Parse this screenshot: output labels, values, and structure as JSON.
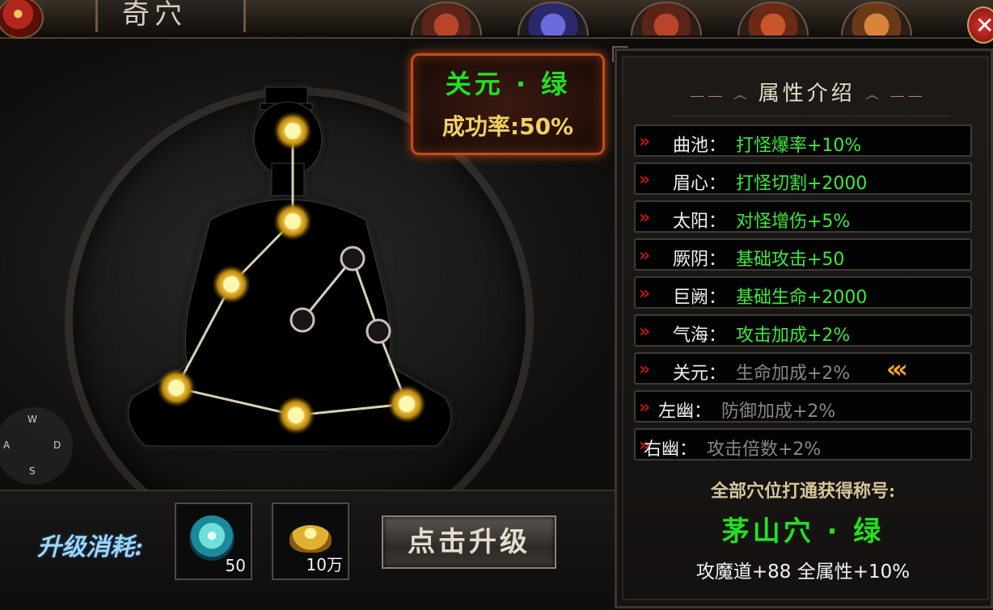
{
  "window": {
    "title": "奇穴",
    "menu_icons": [
      "scroll-icon",
      "flower-icon",
      "robe-icon",
      "pouch-icon",
      "scroll-bundle-icon"
    ],
    "close_icon": "close-icon"
  },
  "acupoint": {
    "name": "关元 · 绿",
    "success_rate": "成功率:50%"
  },
  "meridian": {
    "points": [
      {
        "id": "quchi",
        "lit": true
      },
      {
        "id": "meixin",
        "lit": true
      },
      {
        "id": "taiyang",
        "lit": true
      },
      {
        "id": "jueyin",
        "lit": true
      },
      {
        "id": "juque",
        "lit": true
      },
      {
        "id": "qihai",
        "lit": true
      },
      {
        "id": "guanyuan",
        "lit": false
      },
      {
        "id": "zuoyou",
        "lit": false
      },
      {
        "id": "youyou",
        "lit": false
      }
    ]
  },
  "joystick": {
    "up": "W",
    "left": "A",
    "right": "D",
    "down": "S"
  },
  "upgrade": {
    "cost_label": "升级消耗:",
    "items": [
      {
        "icon": "spirit-orb-icon",
        "qty": "50"
      },
      {
        "icon": "gold-ingot-icon",
        "qty": "10万"
      }
    ],
    "button_label": "点击升级"
  },
  "attributes": {
    "title": "属性介绍",
    "rows": [
      {
        "name": "曲池：",
        "value": "打怪爆率+10%",
        "active": true
      },
      {
        "name": "眉心：",
        "value": "打怪切割+2000",
        "active": true
      },
      {
        "name": "太阳：",
        "value": "对怪增伤+5%",
        "active": true
      },
      {
        "name": "厥阴：",
        "value": "基础攻击+50",
        "active": true
      },
      {
        "name": "巨阙：",
        "value": "基础生命+2000",
        "active": true
      },
      {
        "name": "气海：",
        "value": "攻击加成+2%",
        "active": true
      },
      {
        "name": "关元：",
        "value": "生命加成+2%",
        "active": false,
        "current": true
      },
      {
        "name": "左幽：",
        "value": "防御加成+2%",
        "active": false
      },
      {
        "name": "右幽：",
        "value": "攻击倍数+2%",
        "active": false
      }
    ]
  },
  "reward": {
    "label": "全部穴位打通获得称号:",
    "title": "茅山穴 · 绿",
    "bonus": "攻魔道+88 全属性+10%"
  },
  "colors": {
    "active_green": "#3ee83e",
    "inactive_gray": "#8a8782",
    "gold": "#f2d062",
    "arrow_red": "#b81a12"
  }
}
